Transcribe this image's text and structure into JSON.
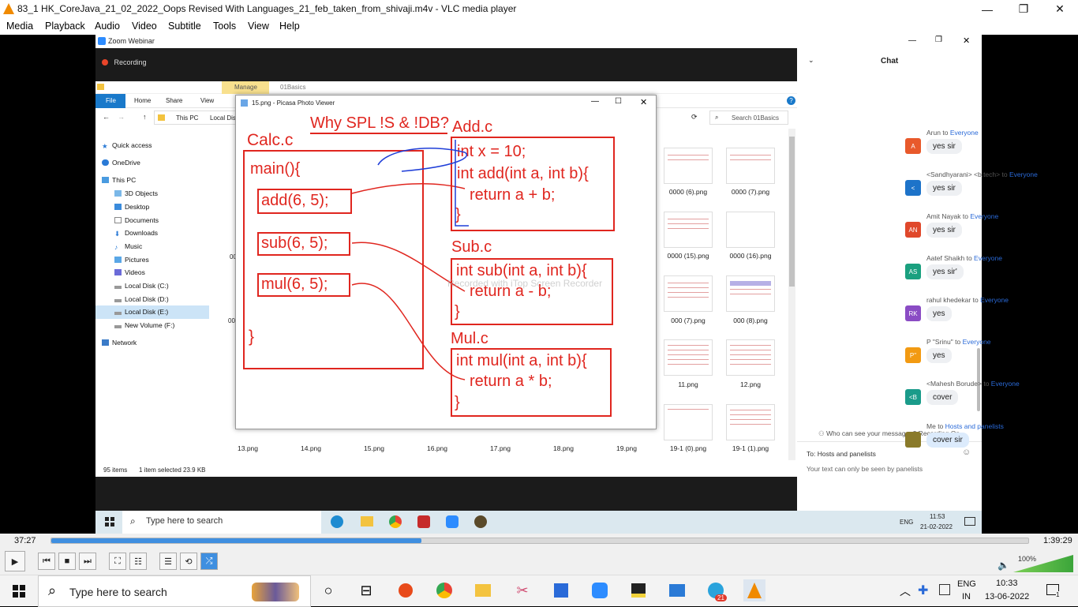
{
  "window": {
    "title": "83_1 HK_CoreJava_21_02_2022_Oops Revised With Languages_21_feb_taken_from_shivaji.m4v - VLC media player"
  },
  "menu": [
    "Media",
    "Playback",
    "Audio",
    "Video",
    "Subtitle",
    "Tools",
    "View",
    "Help"
  ],
  "zoom": {
    "title": "Zoom Webinar",
    "recording": "Recording"
  },
  "explorer": {
    "manage": "Manage",
    "folder_tab": "01Basics",
    "ribbon": [
      "File",
      "Home",
      "Share",
      "View"
    ],
    "path": [
      "This PC",
      "Local Dis"
    ],
    "search_placeholder": "Search 01Basics",
    "sidebar": [
      "Quick access",
      "OneDrive",
      "This PC",
      "3D Objects",
      "Desktop",
      "Documents",
      "Downloads",
      "Music",
      "Pictures",
      "Videos",
      "Local Disk (C:)",
      "Local Disk (D:)",
      "Local Disk (E:)",
      "New Volume (F:)",
      "Network"
    ],
    "right_thumbs": [
      "0000 (6).png",
      "0000 (7).png",
      "0000 (15).png",
      "0000 (16).png",
      "000 (7).png",
      "000 (8).png",
      "11.png",
      "12.png",
      "19-1 (0).png",
      "19-1 (1).png"
    ],
    "bottom_thumbs": [
      "13.png",
      "14.png",
      "15.png",
      "16.png",
      "17.png",
      "18.png",
      "19.png"
    ],
    "left_partial": [
      "00",
      "00"
    ],
    "status": {
      "items": "95 items",
      "selected": "1 item selected  23.9 KB"
    }
  },
  "picasa": {
    "title": "15.png - Picasa Photo Viewer",
    "heading": "Why SPL !S & !DB?",
    "calc_label": "Calc.c",
    "main_sig": "main(){",
    "calls": [
      "add(6, 5);",
      "sub(6, 5);",
      "mul(6, 5);"
    ],
    "close_brace": "}",
    "add_label": "Add.c",
    "add_code": [
      "int x = 10;",
      "int add(int a, int b){",
      "return a + b;",
      "}"
    ],
    "sub_label": "Sub.c",
    "sub_code": [
      "int sub(int a, int b){",
      "return  a - b;",
      "}"
    ],
    "mul_label": "Mul.c",
    "mul_code": [
      "int mul(int a, int b){",
      "return a * b;",
      "}"
    ],
    "watermark": "Recorded with iTop Screen Recorder"
  },
  "inner_taskbar": {
    "search": "Type here to search",
    "lang": "ENG",
    "time": "11:53",
    "date": "21-02-2022"
  },
  "chat": {
    "title": "Chat",
    "messages": [
      {
        "from": "Arun",
        "to": "Everyone",
        "text": "yes sir",
        "initials": "A",
        "color": "#e8592b"
      },
      {
        "from": "<Sandhyarani> <b.tech>",
        "to": "Everyone",
        "text": "yes sir",
        "initials": "<",
        "color": "#1d73c9"
      },
      {
        "from": "Amit Nayak",
        "to": "Everyone",
        "text": "yes sir",
        "initials": "AN",
        "color": "#e0482b"
      },
      {
        "from": "Aatef Shaikh",
        "to": "Everyone",
        "text": "yes sir'",
        "initials": "AS",
        "color": "#1aa07f"
      },
      {
        "from": "rahul khedekar",
        "to": "Everyone",
        "text": "yes",
        "initials": "RK",
        "color": "#8a4cc4"
      },
      {
        "from": "P \"Srinu\"",
        "to": "Everyone",
        "text": "yes",
        "initials": "P\"",
        "color": "#f29a12"
      },
      {
        "from": "<Mahesh Borude>",
        "to": "Everyone",
        "text": "cover",
        "initials": "<B",
        "color": "#1a9b8a"
      },
      {
        "from": "Me",
        "to": "Hosts and panelists",
        "text": "cover sir",
        "initials": "",
        "color": "#8a7a2a"
      }
    ],
    "to_word": "to",
    "visibility": "Who can see your messages? Recording On",
    "to_line": "To:  Hosts and panelists",
    "note": "Your text can only be seen by panelists"
  },
  "player": {
    "elapsed": "37:27",
    "total": "1:39:29",
    "progress": 0.379,
    "volume": "100%",
    "volume_level": 1.0
  },
  "taskbar": {
    "search": "Type here to search",
    "lang1": "ENG",
    "lang2": "IN",
    "time": "10:33",
    "date": "13-06-2022",
    "telegram_badge": "21",
    "notif": "1"
  }
}
